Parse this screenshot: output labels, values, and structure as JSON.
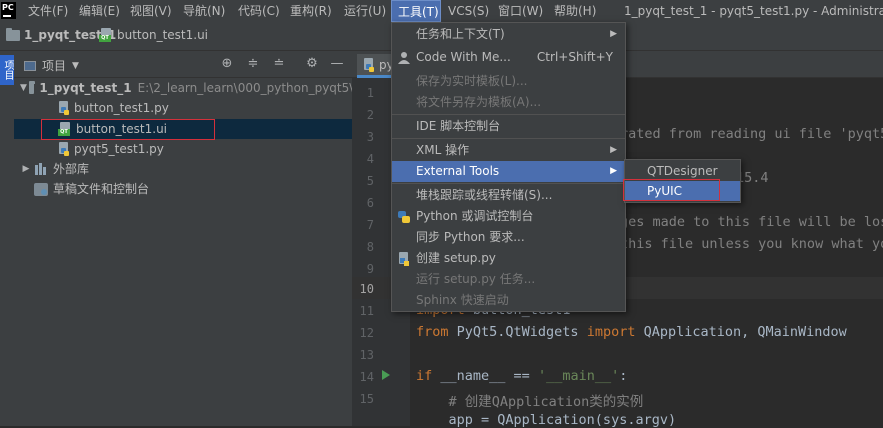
{
  "menubar": {
    "logo": "PC",
    "items": [
      "文件(F)",
      "编辑(E)",
      "视图(V)",
      "导航(N)",
      "代码(C)",
      "重构(R)",
      "运行(U)",
      "工具(T)",
      "VCS(S)",
      "窗口(W)",
      "帮助(H)"
    ],
    "window_title": "1_pyqt_test_1 - pyqt5_test1.py - Administrato"
  },
  "breadcrumb": {
    "project": "1_pyqt_test_1",
    "file": "button_test1.ui"
  },
  "left_strip": {
    "tab_label": "项目"
  },
  "project_panel": {
    "title": "项目",
    "tree": [
      {
        "label": "1_pyqt_test_1",
        "path": "E:\\2_learn_learn\\000_python_pyqt5\\("
      },
      {
        "label": "button_test1.py"
      },
      {
        "label": "button_test1.ui"
      },
      {
        "label": "pyqt5_test1.py"
      },
      {
        "label": "外部库"
      },
      {
        "label": "草稿文件和控制台"
      }
    ]
  },
  "editor": {
    "tab_label": "py",
    "line_numbers": [
      "1",
      "2",
      "3",
      "4",
      "5",
      "6",
      "7",
      "8",
      "9",
      "10",
      "11",
      "12",
      "13",
      "14",
      "15"
    ],
    "code": {
      "line3": "rated from reading ui file 'pyqt5",
      "line5": "15.4",
      "line7": "ges made to this file will be los",
      "line8": "this file unless you know what yo",
      "line11_kw": "import",
      "line11_rest": " button_test1",
      "line12_kw1": "from",
      "line12_mod": " PyQt5.QtWidgets ",
      "line12_kw2": "import",
      "line12_rest": " QApplication, QMainWindow",
      "line14_kw": "if",
      "line14_rest": " __name__ == ",
      "line14_str": "'__main__'",
      "line14_end": ":",
      "line15": "    # 创建QApplication类的实例",
      "line16": "    app = QApplication(sys.argv)"
    }
  },
  "tools_menu": {
    "items": [
      {
        "label": "任务和上下文(T)",
        "submenu": true
      },
      {
        "label": "Code With Me...",
        "shortcut": "Ctrl+Shift+Y"
      },
      {
        "label": "保存为实时模板(L)...",
        "disabled": true
      },
      {
        "label": "将文件另存为模板(A)...",
        "disabled": true
      },
      {
        "label": "IDE 脚本控制台"
      },
      {
        "label": "XML 操作",
        "submenu": true
      },
      {
        "label": "External Tools",
        "submenu": true,
        "highlighted": true
      },
      {
        "label": "堆栈跟踪或线程转储(S)..."
      },
      {
        "label": "Python 或调试控制台"
      },
      {
        "label": "同步 Python 要求..."
      },
      {
        "label": "创建 setup.py"
      },
      {
        "label": "运行 setup.py 任务...",
        "disabled": true
      },
      {
        "label": "Sphinx 快速启动",
        "disabled": true
      }
    ]
  },
  "external_tools_submenu": {
    "items": [
      "QTDesigner",
      "PyUIC"
    ],
    "highlighted": "PyUIC"
  },
  "colors": {
    "menu_highlight": "#4b6eaf",
    "annotation_red": "#d3303b",
    "background": "#2b2b2b",
    "panel": "#3c3f41"
  }
}
